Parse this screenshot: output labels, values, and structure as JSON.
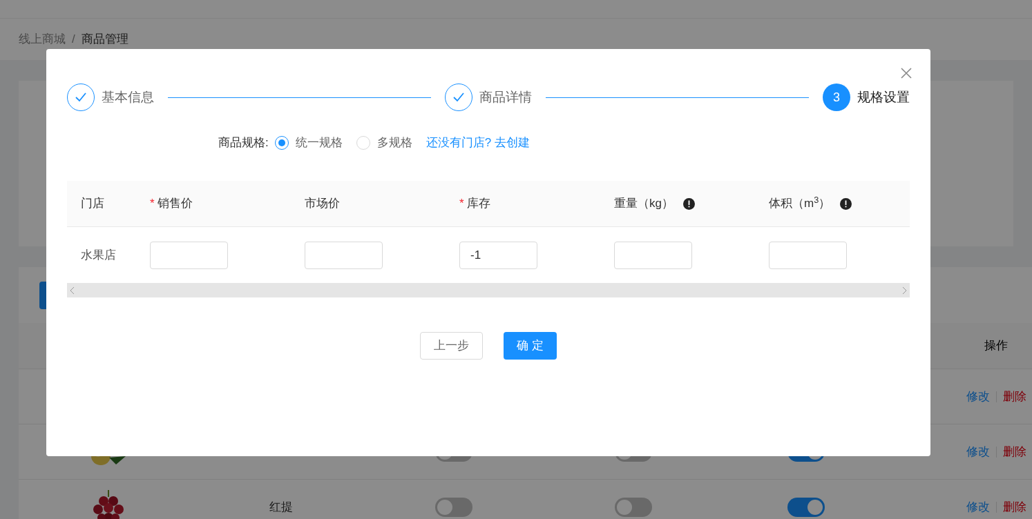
{
  "breadcrumb": [
    {
      "label": "线上商城",
      "current": false
    },
    {
      "label": "/",
      "current": false
    },
    {
      "label": "商品管理",
      "current": true
    }
  ],
  "product_table": {
    "action_header": "操作",
    "rows": [
      {
        "actions": [
          {
            "label": "修改",
            "kind": "edit"
          },
          {
            "label": "删除",
            "kind": "delete"
          }
        ]
      },
      {
        "kind": "picture",
        "toggles": [
          {
            "on": false
          },
          {
            "on": false
          },
          {
            "on": true
          }
        ],
        "actions": [
          {
            "label": "修改",
            "kind": "edit"
          },
          {
            "label": "删除",
            "kind": "delete"
          }
        ]
      },
      {
        "kind": "picture",
        "name": "红提",
        "toggles": [
          {
            "on": false
          },
          {
            "on": false
          },
          {
            "on": true
          }
        ],
        "actions": [
          {
            "label": "修改",
            "kind": "edit"
          },
          {
            "label": "删除",
            "kind": "delete"
          }
        ]
      }
    ]
  },
  "dialog": {
    "steps": [
      {
        "label": "基本信息",
        "done": true
      },
      {
        "label": "商品详情",
        "done": true
      },
      {
        "number": "3",
        "label": "规格设置",
        "done": false
      }
    ],
    "spec": {
      "label": "商品规格:",
      "options": [
        {
          "label": "统一规格",
          "selected": true
        },
        {
          "label": "多规格",
          "selected": false
        }
      ],
      "link": "还没有门店? 去创建"
    },
    "table": {
      "columns": [
        {
          "label": "门店",
          "hint": false
        },
        {
          "required_mark": "*",
          "label": "销售价",
          "hint": false
        },
        {
          "label": "市场价",
          "hint": false
        },
        {
          "required_mark": "*",
          "label": "库存",
          "hint": false
        },
        {
          "label": "重量（kg）",
          "hint": true
        },
        {
          "label": "体积（m$^{3}$）",
          "hint": true
        }
      ],
      "rows": [
        {
          "store": "水果店",
          "stock": "-1"
        }
      ]
    },
    "buttons": [
      {
        "label": "上一步",
        "kind": "default"
      },
      {
        "label": "确 定",
        "kind": "primary"
      }
    ]
  }
}
